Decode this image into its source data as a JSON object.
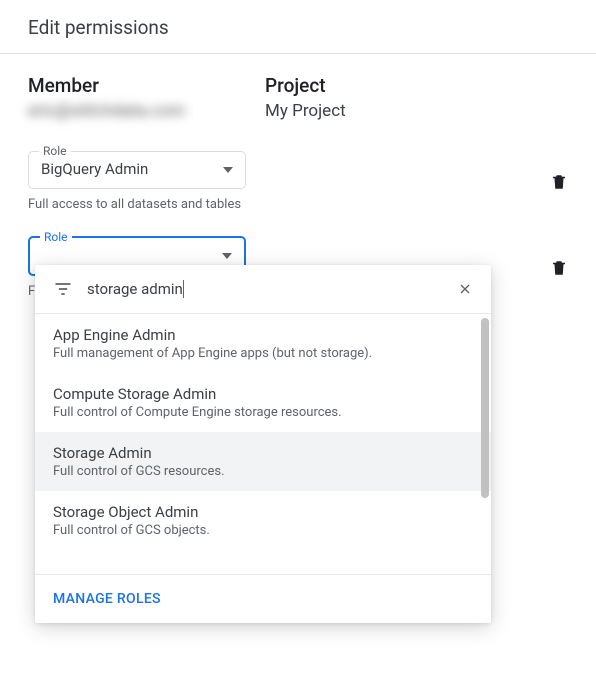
{
  "header": {
    "title": "Edit permissions"
  },
  "member": {
    "label": "Member",
    "value": "eric@stitchdata.com"
  },
  "project": {
    "label": "Project",
    "value": "My Project"
  },
  "role1": {
    "float_label": "Role",
    "value": "BigQuery Admin",
    "hint": "Full access to all datasets and tables"
  },
  "role2": {
    "float_label": "Role",
    "hint_prefix": "Fu"
  },
  "search": {
    "value": "storage admin"
  },
  "options": [
    {
      "title": "App Engine Admin",
      "desc": "Full management of App Engine apps (but not storage)."
    },
    {
      "title": "Compute Storage Admin",
      "desc": "Full control of Compute Engine storage resources."
    },
    {
      "title": "Storage Admin",
      "desc": "Full control of GCS resources."
    },
    {
      "title": "Storage Object Admin",
      "desc": "Full control of GCS objects."
    }
  ],
  "footer": {
    "manage_roles": "MANAGE ROLES"
  }
}
